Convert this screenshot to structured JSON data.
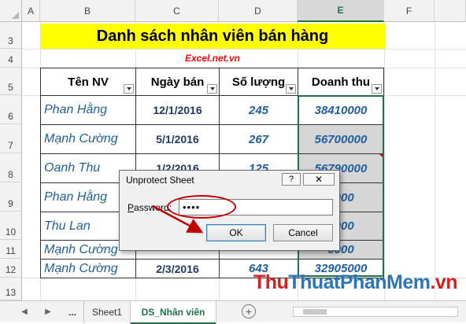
{
  "columns": [
    "A",
    "B",
    "C",
    "D",
    "E",
    "F"
  ],
  "rows": [
    "3",
    "4",
    "5",
    "6",
    "7",
    "8",
    "9",
    "10",
    "11",
    "12",
    "13"
  ],
  "title": "Danh sách nhân viên bán hàng",
  "subtitle": "Excel.net.vn",
  "headers": [
    "Tên NV",
    "Ngày bán",
    "Số lượng",
    "Doanh thu"
  ],
  "records": [
    {
      "name": "Phan Hằng",
      "date": "12/1/2016",
      "qty": "245",
      "revenue": "38410000"
    },
    {
      "name": "Mạnh Cường",
      "date": "5/1/2016",
      "qty": "267",
      "revenue": "56700000"
    },
    {
      "name": "Oanh Thu",
      "date": "1/2/2016",
      "qty": "125",
      "revenue": "56790000"
    },
    {
      "name": "Phan Hằng",
      "date": "",
      "qty": "",
      "revenue": "0000"
    },
    {
      "name": "Thu Lan",
      "date": "",
      "qty": "",
      "revenue": "5000"
    },
    {
      "name": "Mạnh Cường",
      "date": "",
      "qty": "",
      "revenue": "0000"
    },
    {
      "name": "Mạnh Cường",
      "date": "2/3/2016",
      "qty": "643",
      "revenue": "32905000"
    }
  ],
  "tabs": {
    "more": "...",
    "sheet1": "Sheet1",
    "active": "DS_Nhân viên",
    "add": "+"
  },
  "dialog": {
    "title": "Unprotect Sheet",
    "help": "?",
    "close": "✕",
    "password_label": "Password:",
    "password_value": "••••",
    "ok": "OK",
    "cancel": "Cancel"
  },
  "watermark": {
    "part1": "Thu",
    "part2": "ThuatPhanMem",
    "part3": ".vn"
  },
  "colors": {
    "accent": "#217346",
    "title_bg": "#ffff00",
    "subtitle": "#ff0000",
    "annotation": "#c00000"
  }
}
